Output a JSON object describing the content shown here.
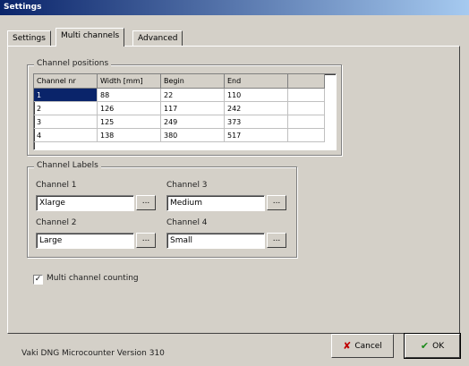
{
  "window": {
    "title": "Settings"
  },
  "tabs": [
    {
      "label": "Settings"
    },
    {
      "label": "Multi channels"
    },
    {
      "label": "Advanced"
    }
  ],
  "channel_positions": {
    "label": "Channel positions",
    "columns": [
      "Channel nr",
      "Width [mm]",
      "Begin",
      "End",
      ""
    ],
    "rows": [
      [
        "1",
        "88",
        "22",
        "110",
        ""
      ],
      [
        "2",
        "126",
        "117",
        "242",
        ""
      ],
      [
        "3",
        "125",
        "249",
        "373",
        ""
      ],
      [
        "4",
        "138",
        "380",
        "517",
        ""
      ]
    ]
  },
  "channel_labels": {
    "label": "Channel Labels",
    "channels": [
      {
        "label": "Channel 1",
        "value": "Xlarge",
        "button": "..."
      },
      {
        "label": "Channel 2",
        "value": "Large",
        "button": "..."
      },
      {
        "label": "Channel 3",
        "value": "Medium",
        "button": "..."
      },
      {
        "label": "Channel 4",
        "value": "Small",
        "button": "..."
      }
    ]
  },
  "multi_channel": {
    "label": "Multi channel counting",
    "checked": true,
    "mark": "✓"
  },
  "status": {
    "text": "Vaki DNG   Microcounter Version 310"
  },
  "buttons": {
    "cancel": {
      "label": "Cancel",
      "icon": "x-icon",
      "icon_glyph": "✘",
      "icon_color": "#c00000"
    },
    "ok": {
      "label": "OK",
      "icon": "check-icon",
      "icon_glyph": "✔",
      "icon_color": "#1a8a1a"
    }
  }
}
